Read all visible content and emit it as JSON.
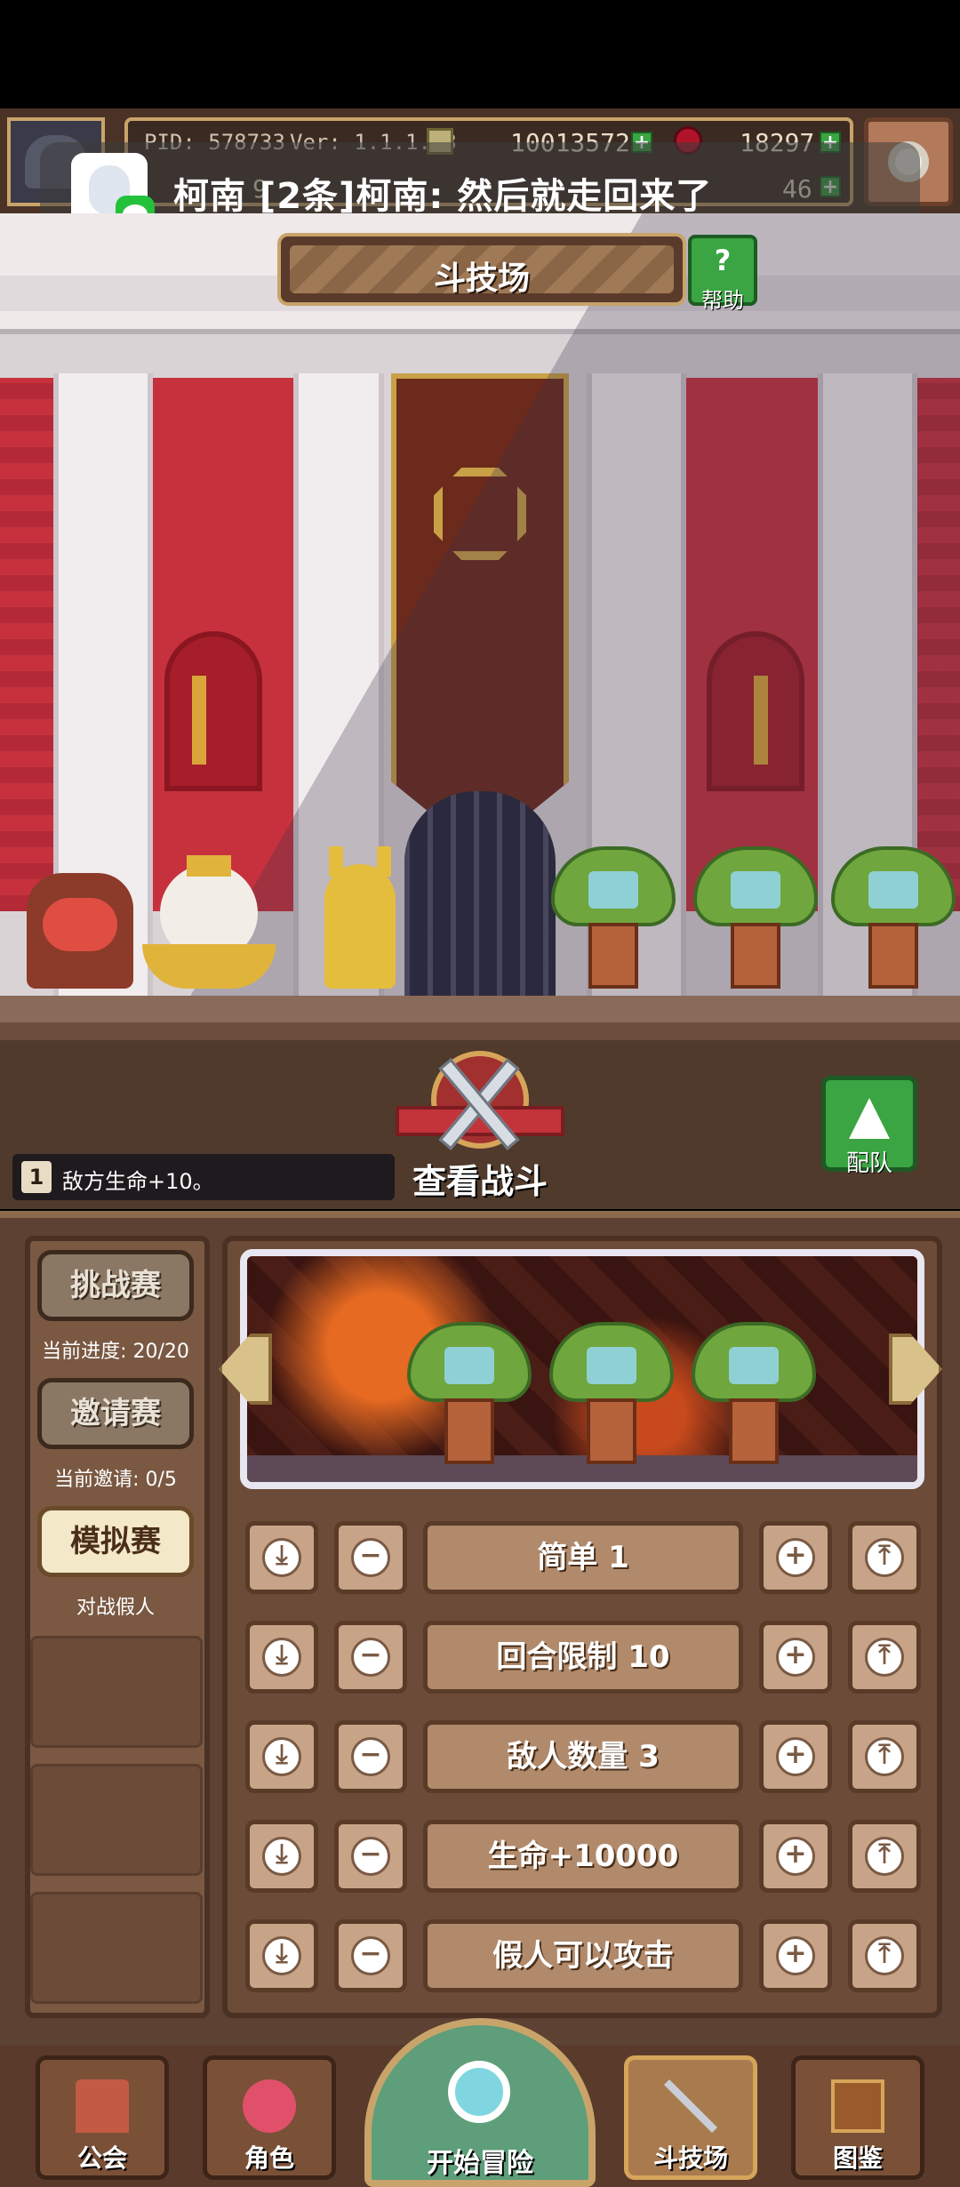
{
  "top_bar": {
    "pid": "PID: 578733",
    "version": "Ver: 1.1.1.13",
    "coins": "10013572",
    "gems": "18297",
    "second_currency": "46",
    "partial_value": "9"
  },
  "notification": {
    "text": "柯南  [2条]柯南: 然后就走回来了"
  },
  "title": {
    "text": "斗技场",
    "help_label": "帮助"
  },
  "effect": {
    "index": "1",
    "text": "敌方生命+10。"
  },
  "battle": {
    "watch_label": "查看战斗",
    "team_label": "配队"
  },
  "modes": [
    {
      "label": "挑战赛",
      "sub": "当前进度: 20/20"
    },
    {
      "label": "邀请赛",
      "sub": "当前邀请: 0/5"
    },
    {
      "label": "模拟赛",
      "sub": "对战假人"
    }
  ],
  "settings": [
    {
      "label": "简单 1"
    },
    {
      "label": "回合限制 10"
    },
    {
      "label": "敌人数量 3"
    },
    {
      "label": "生命+10000"
    },
    {
      "label": "假人可以攻击"
    }
  ],
  "nav": {
    "items": [
      "公会",
      "角色",
      "开始冒险",
      "斗技场",
      "图鉴"
    ]
  },
  "colors": {
    "accent_green": "#3aa542",
    "frame_gold": "#c9a46a",
    "wall_red": "#c7313e"
  }
}
